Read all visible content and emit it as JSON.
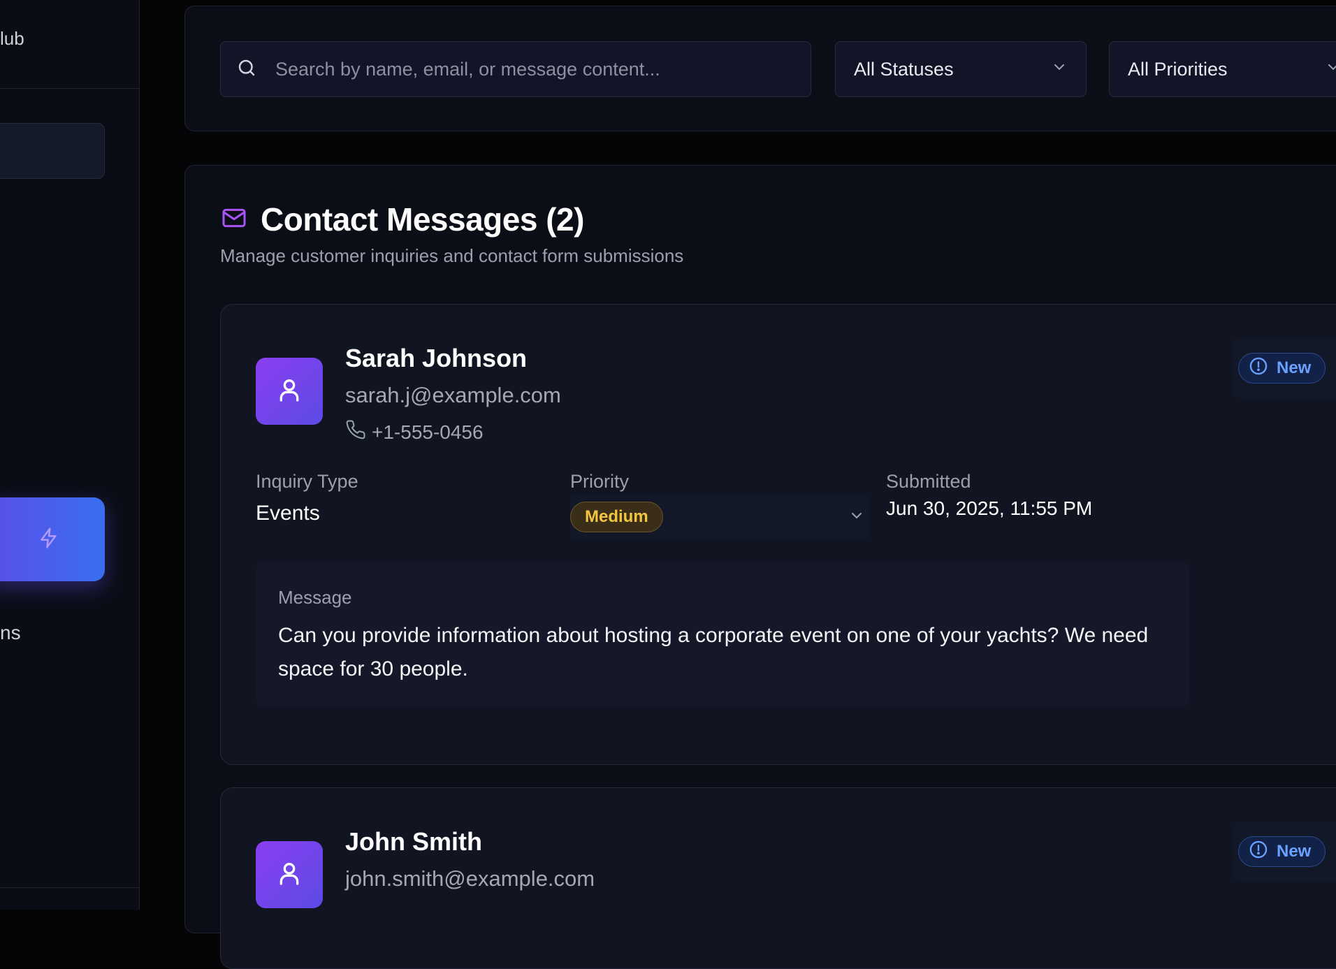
{
  "sidebar": {
    "brand_fragment": "lub",
    "nav_fragment": "ns"
  },
  "filters": {
    "search_placeholder": "Search by name, email, or message content...",
    "status_select": "All Statuses",
    "priority_select": "All Priorities"
  },
  "messages": {
    "title": "Contact Messages (2)",
    "subtitle": "Manage customer inquiries and contact form submissions",
    "field_labels": {
      "inquiry_type": "Inquiry Type",
      "priority": "Priority",
      "submitted": "Submitted",
      "message": "Message"
    },
    "items": [
      {
        "name": "Sarah Johnson",
        "email": "sarah.j@example.com",
        "phone": "+1-555-0456",
        "status": "New",
        "inquiry_type": "Events",
        "priority": "Medium",
        "submitted": "Jun 30, 2025, 11:55 PM",
        "message": "Can you provide information about hosting a corporate event on one of your yachts? We need space for 30 people."
      },
      {
        "name": "John Smith",
        "email": "john.smith@example.com",
        "status": "New"
      }
    ]
  },
  "colors": {
    "accent_purple": "#8b3ef0",
    "accent_blue": "#3a6ef0",
    "status_new": "#6aa1ff",
    "priority_medium": "#f2c541",
    "mail_icon": "#a855f7"
  },
  "icons": {
    "search": "search-icon",
    "chevron": "chevron-down-icon",
    "mail": "mail-icon",
    "user": "user-icon",
    "phone": "phone-icon",
    "alert": "alert-circle-icon",
    "bolt": "bolt-icon"
  }
}
